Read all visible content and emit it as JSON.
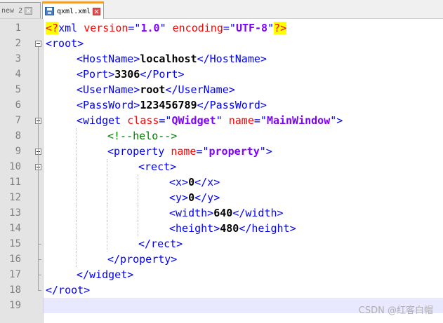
{
  "tabs": [
    {
      "label": "new 2",
      "active": false
    },
    {
      "label": "qxml.xml",
      "active": true
    }
  ],
  "lines": [
    {
      "n": "1",
      "indent": 0,
      "tokens": [
        [
          "pi",
          "<?"
        ],
        [
          "tag",
          "xml "
        ],
        [
          "attr",
          "version"
        ],
        [
          "tag",
          "=\""
        ],
        [
          "str",
          "1.0"
        ],
        [
          "tag",
          "\" "
        ],
        [
          "attr",
          "encoding"
        ],
        [
          "tag",
          "=\""
        ],
        [
          "str",
          "UTF-8"
        ],
        [
          "tag",
          "\""
        ],
        [
          "pi",
          "?>"
        ]
      ]
    },
    {
      "n": "2",
      "indent": 0,
      "tokens": [
        [
          "tag",
          "<root>"
        ]
      ]
    },
    {
      "n": "3",
      "indent": 1,
      "tokens": [
        [
          "tag",
          "<HostName>"
        ],
        [
          "text",
          "localhost"
        ],
        [
          "tag",
          "</HostName>"
        ]
      ]
    },
    {
      "n": "4",
      "indent": 1,
      "tokens": [
        [
          "tag",
          "<Port>"
        ],
        [
          "text",
          "3306"
        ],
        [
          "tag",
          "</Port>"
        ]
      ]
    },
    {
      "n": "5",
      "indent": 1,
      "tokens": [
        [
          "tag",
          "<UserName>"
        ],
        [
          "text",
          "root"
        ],
        [
          "tag",
          "</UserName>"
        ]
      ]
    },
    {
      "n": "6",
      "indent": 1,
      "tokens": [
        [
          "tag",
          "<PassWord>"
        ],
        [
          "text",
          "123456789"
        ],
        [
          "tag",
          "</PassWord>"
        ]
      ]
    },
    {
      "n": "7",
      "indent": 1,
      "tokens": [
        [
          "tag",
          "<widget "
        ],
        [
          "attr",
          "class"
        ],
        [
          "tag",
          "=\""
        ],
        [
          "str",
          "QWidget"
        ],
        [
          "tag",
          "\" "
        ],
        [
          "attr",
          "name"
        ],
        [
          "tag",
          "=\""
        ],
        [
          "str",
          "MainWindow"
        ],
        [
          "tag",
          "\">"
        ]
      ]
    },
    {
      "n": "8",
      "indent": 2,
      "tokens": [
        [
          "cmt",
          "<!--helo-->"
        ]
      ]
    },
    {
      "n": "9",
      "indent": 2,
      "tokens": [
        [
          "tag",
          "<property "
        ],
        [
          "attr",
          "name"
        ],
        [
          "tag",
          "=\""
        ],
        [
          "str",
          "property"
        ],
        [
          "tag",
          "\">"
        ]
      ]
    },
    {
      "n": "10",
      "indent": 3,
      "tokens": [
        [
          "tag",
          "<rect>"
        ]
      ]
    },
    {
      "n": "11",
      "indent": 4,
      "tokens": [
        [
          "tag",
          "<x>"
        ],
        [
          "text",
          "0"
        ],
        [
          "tag",
          "</x>"
        ]
      ]
    },
    {
      "n": "12",
      "indent": 4,
      "tokens": [
        [
          "tag",
          "<y>"
        ],
        [
          "text",
          "0"
        ],
        [
          "tag",
          "</y>"
        ]
      ]
    },
    {
      "n": "13",
      "indent": 4,
      "tokens": [
        [
          "tag",
          "<width>"
        ],
        [
          "text",
          "640"
        ],
        [
          "tag",
          "</width>"
        ]
      ]
    },
    {
      "n": "14",
      "indent": 4,
      "tokens": [
        [
          "tag",
          "<height>"
        ],
        [
          "text",
          "480"
        ],
        [
          "tag",
          "</height>"
        ]
      ]
    },
    {
      "n": "15",
      "indent": 3,
      "tokens": [
        [
          "tag",
          "</rect>"
        ]
      ]
    },
    {
      "n": "16",
      "indent": 2,
      "tokens": [
        [
          "tag",
          "</property>"
        ]
      ]
    },
    {
      "n": "17",
      "indent": 1,
      "tokens": [
        [
          "tag",
          "</widget>"
        ]
      ]
    },
    {
      "n": "18",
      "indent": 0,
      "tokens": [
        [
          "tag",
          "</root>"
        ]
      ]
    },
    {
      "n": "19",
      "indent": 0,
      "tokens": []
    }
  ],
  "fold_markers": [
    "2",
    "7",
    "9",
    "10"
  ],
  "current_line": "19",
  "watermark": "CSDN @红客白帽",
  "colors": {
    "tag": "#0000ff",
    "attribute": "#ff0000",
    "attribute_value": "#8000ff",
    "comment": "#008000",
    "current_line_bg": "#e8e8ff",
    "active_tab_accent": "#f0a030"
  }
}
